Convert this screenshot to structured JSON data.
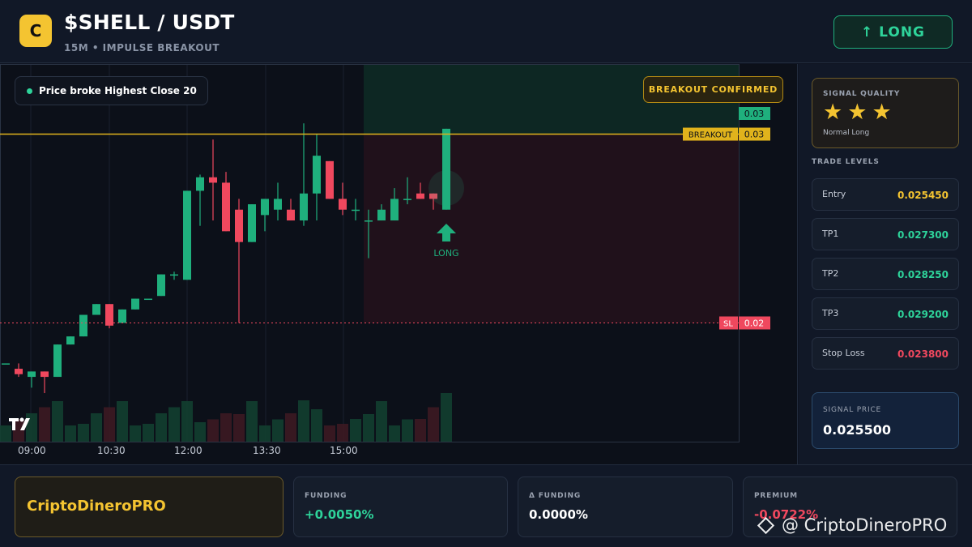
{
  "header": {
    "logo_letter": "C",
    "pair": "$SHELL / USDT",
    "subtitle": "15M • IMPULSE BREAKOUT",
    "signal_button": "↑ LONG"
  },
  "chart": {
    "note_text": "Price broke Highest Close 20",
    "badge_text": "BREAKOUT CONFIRMED",
    "tv_logo": "TV",
    "long_marker": "LONG",
    "price_tags": {
      "top": "0.03",
      "breakout_label": "BREAKOUT",
      "breakout_value": "0.03",
      "sl_label": "SL",
      "sl_value": "0.02"
    },
    "x_labels": [
      "09:00",
      "10:30",
      "12:00",
      "13:30",
      "15:00"
    ]
  },
  "chart_data": {
    "type": "candlestick",
    "title": "$SHELL / USDT",
    "x_labels": [
      "09:00",
      "10:30",
      "12:00",
      "13:30",
      "15:00"
    ],
    "breakout_level": 0.0273,
    "stop_loss_level": 0.0238,
    "candles": [
      {
        "o": 0.02305,
        "h": 0.02305,
        "l": 0.02305,
        "c": 0.02305,
        "v": 0.05
      },
      {
        "o": 0.02295,
        "h": 0.02305,
        "l": 0.0228,
        "c": 0.02285,
        "v": 0.05
      },
      {
        "o": 0.0228,
        "h": 0.0229,
        "l": 0.0226,
        "c": 0.0229,
        "v": 0.05
      },
      {
        "o": 0.0229,
        "h": 0.0229,
        "l": 0.0225,
        "c": 0.0228,
        "v": 0.05
      },
      {
        "o": 0.0228,
        "h": 0.0234,
        "l": 0.0228,
        "c": 0.0234,
        "v": 0.05
      },
      {
        "o": 0.0234,
        "h": 0.02355,
        "l": 0.0234,
        "c": 0.02355,
        "v": 0.05
      },
      {
        "o": 0.02355,
        "h": 0.02395,
        "l": 0.02355,
        "c": 0.02395,
        "v": 0.04
      },
      {
        "o": 0.02395,
        "h": 0.02415,
        "l": 0.02405,
        "c": 0.02415,
        "v": 0.05
      },
      {
        "o": 0.02415,
        "h": 0.02415,
        "l": 0.0237,
        "c": 0.02375,
        "v": 0.05
      },
      {
        "o": 0.0238,
        "h": 0.02405,
        "l": 0.0238,
        "c": 0.02405,
        "v": 0.05
      },
      {
        "o": 0.02405,
        "h": 0.02425,
        "l": 0.02405,
        "c": 0.02425,
        "v": 0.05
      },
      {
        "o": 0.02425,
        "h": 0.02425,
        "l": 0.02425,
        "c": 0.02425,
        "v": 0.04
      },
      {
        "o": 0.0243,
        "h": 0.0247,
        "l": 0.0243,
        "c": 0.0247,
        "v": 0.05
      },
      {
        "o": 0.0247,
        "h": 0.02475,
        "l": 0.0246,
        "c": 0.0247,
        "v": 0.05
      },
      {
        "o": 0.0246,
        "h": 0.02625,
        "l": 0.0246,
        "c": 0.02625,
        "v": 0.05
      },
      {
        "o": 0.02625,
        "h": 0.02655,
        "l": 0.0256,
        "c": 0.0265,
        "v": 0.06
      },
      {
        "o": 0.0265,
        "h": 0.0272,
        "l": 0.0257,
        "c": 0.0264,
        "v": 0.05
      },
      {
        "o": 0.0264,
        "h": 0.0266,
        "l": 0.0255,
        "c": 0.0255,
        "v": 0.05
      },
      {
        "o": 0.0259,
        "h": 0.0261,
        "l": 0.0238,
        "c": 0.0253,
        "v": 0.04
      },
      {
        "o": 0.0253,
        "h": 0.026,
        "l": 0.0253,
        "c": 0.026,
        "v": 0.05
      },
      {
        "o": 0.0258,
        "h": 0.0261,
        "l": 0.0255,
        "c": 0.0261,
        "v": 0.05
      },
      {
        "o": 0.0259,
        "h": 0.0264,
        "l": 0.0257,
        "c": 0.0261,
        "v": 0.05
      },
      {
        "o": 0.0259,
        "h": 0.0261,
        "l": 0.0257,
        "c": 0.0257,
        "v": 0.05
      },
      {
        "o": 0.0257,
        "h": 0.0275,
        "l": 0.0256,
        "c": 0.0262,
        "v": 0.06
      },
      {
        "o": 0.0262,
        "h": 0.0273,
        "l": 0.0257,
        "c": 0.0269,
        "v": 0.04
      },
      {
        "o": 0.0268,
        "h": 0.0268,
        "l": 0.0261,
        "c": 0.0261,
        "v": 0.05
      },
      {
        "o": 0.0261,
        "h": 0.0264,
        "l": 0.0258,
        "c": 0.0259,
        "v": 0.04
      },
      {
        "o": 0.0259,
        "h": 0.0261,
        "l": 0.0257,
        "c": 0.0259,
        "v": 0.04
      },
      {
        "o": 0.0257,
        "h": 0.0259,
        "l": 0.025,
        "c": 0.0257,
        "v": 0.04
      },
      {
        "o": 0.0257,
        "h": 0.026,
        "l": 0.0257,
        "c": 0.0259,
        "v": 0.05
      },
      {
        "o": 0.0257,
        "h": 0.0263,
        "l": 0.0257,
        "c": 0.0261,
        "v": 0.05
      },
      {
        "o": 0.0261,
        "h": 0.0265,
        "l": 0.026,
        "c": 0.0261,
        "v": 0.05
      },
      {
        "o": 0.0262,
        "h": 0.0264,
        "l": 0.0261,
        "c": 0.0261,
        "v": 0.04
      },
      {
        "o": 0.0262,
        "h": 0.0262,
        "l": 0.0259,
        "c": 0.0261,
        "v": 0.05
      },
      {
        "o": 0.0259,
        "h": 0.0274,
        "l": 0.0259,
        "c": 0.0274,
        "v": 0.06
      }
    ]
  },
  "signal": {
    "quality_title": "SIGNAL QUALITY",
    "stars": 3,
    "star_glyph": "★",
    "quality_label": "Normal Long",
    "levels_title": "TRADE LEVELS",
    "levels": [
      {
        "name": "Entry",
        "value": "0.025450",
        "color": "#f4c431"
      },
      {
        "name": "TP1",
        "value": "0.027300",
        "color": "#2ed39a"
      },
      {
        "name": "TP2",
        "value": "0.028250",
        "color": "#2ed39a"
      },
      {
        "name": "TP3",
        "value": "0.029200",
        "color": "#2ed39a"
      },
      {
        "name": "Stop Loss",
        "value": "0.023800",
        "color": "#f0485e"
      }
    ],
    "price_title": "SIGNAL PRICE",
    "price_value": "0.025500"
  },
  "footer": {
    "brand": "CriptoDineroPRO",
    "stats": [
      {
        "title": "FUNDING",
        "value": "+0.0050%",
        "color": "#2ed39a"
      },
      {
        "title": "Δ FUNDING",
        "value": "0.0000%",
        "color": "#ffffff"
      },
      {
        "title": "PREMIUM",
        "value": "-0.0722%",
        "color": "#f0485e"
      }
    ],
    "watermark": "@ CriptoDineroPRO"
  },
  "colors": {
    "up": "#1fb07d",
    "down": "#f0485e",
    "breakout": "#e0b31c",
    "accent": "#f4c431"
  }
}
